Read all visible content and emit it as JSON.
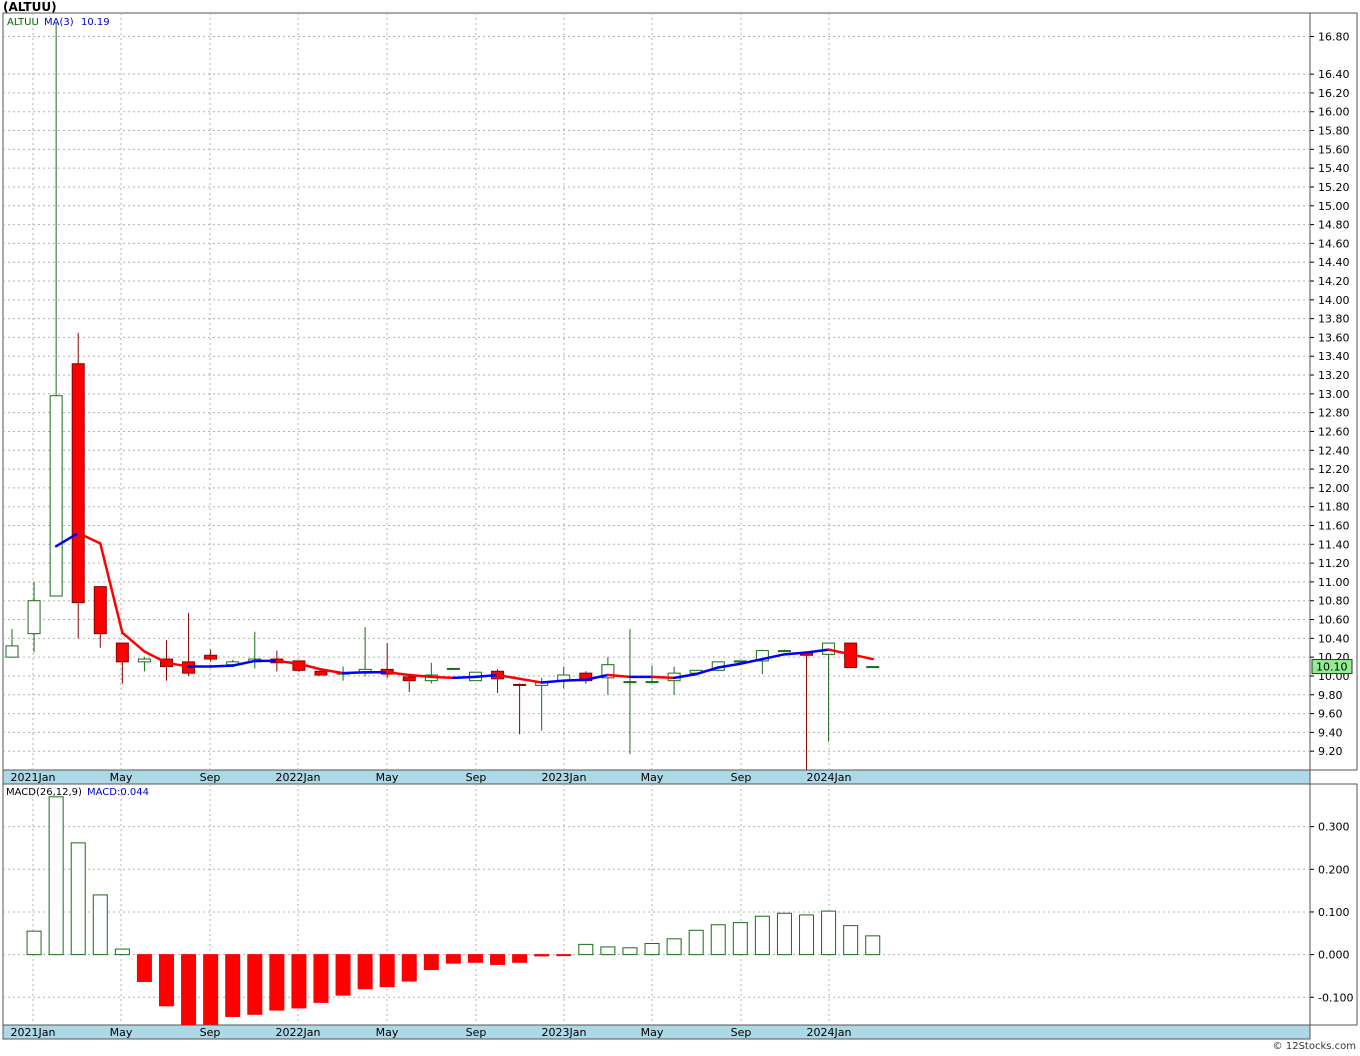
{
  "title": "(ALTUU)",
  "footer": "© 12Stocks.com",
  "colors": {
    "up": "#1a6b1a",
    "down": "#ff0000",
    "ma_up": "#0000ff",
    "ma_down": "#ff0000",
    "axis_band": "#add8e6",
    "last_box": "#90ee90"
  },
  "chart_data": [
    {
      "type": "candlestick",
      "legend": {
        "symbol": "ALTUU",
        "ma_label": "MA(3)",
        "ma_value": "10.19"
      },
      "last_price_label": "10.10",
      "ylim": [
        9.0,
        17.05
      ],
      "y_ticks": [
        "16.80",
        "16.40",
        "16.20",
        "16.00",
        "15.80",
        "15.60",
        "15.40",
        "15.20",
        "15.00",
        "14.80",
        "14.60",
        "14.40",
        "14.20",
        "14.00",
        "13.80",
        "13.60",
        "13.40",
        "13.20",
        "13.00",
        "12.80",
        "12.60",
        "12.40",
        "12.20",
        "12.00",
        "11.80",
        "11.60",
        "11.40",
        "11.20",
        "11.00",
        "10.80",
        "10.60",
        "10.40",
        "10.20",
        "10.00",
        "9.80",
        "9.60",
        "9.40",
        "9.20"
      ],
      "x_labels": [
        "2021Jan",
        "May",
        "Sep",
        "2022Jan",
        "May",
        "Sep",
        "2023Jan",
        "May",
        "Sep",
        "2024Jan"
      ],
      "candles": [
        {
          "o": 10.2,
          "h": 10.5,
          "l": 10.2,
          "c": 10.32
        },
        {
          "o": 10.45,
          "h": 11.0,
          "l": 10.25,
          "c": 10.8
        },
        {
          "o": 10.85,
          "h": 16.95,
          "l": 10.85,
          "c": 12.98
        },
        {
          "o": 13.32,
          "h": 13.65,
          "l": 10.4,
          "c": 10.78
        },
        {
          "o": 10.95,
          "h": 10.95,
          "l": 10.3,
          "c": 10.45
        },
        {
          "o": 10.35,
          "h": 10.35,
          "l": 9.92,
          "c": 10.15
        },
        {
          "o": 10.15,
          "h": 10.2,
          "l": 10.05,
          "c": 10.18
        },
        {
          "o": 10.18,
          "h": 10.38,
          "l": 9.95,
          "c": 10.1
        },
        {
          "o": 10.15,
          "h": 10.67,
          "l": 10.0,
          "c": 10.03
        },
        {
          "o": 10.22,
          "h": 10.28,
          "l": 10.15,
          "c": 10.18
        },
        {
          "o": 10.12,
          "h": 10.17,
          "l": 10.1,
          "c": 10.15
        },
        {
          "o": 10.15,
          "h": 10.47,
          "l": 10.08,
          "c": 10.18
        },
        {
          "o": 10.18,
          "h": 10.27,
          "l": 10.05,
          "c": 10.14
        },
        {
          "o": 10.16,
          "h": 10.16,
          "l": 10.04,
          "c": 10.06
        },
        {
          "o": 10.05,
          "h": 10.05,
          "l": 10.01,
          "c": 10.01
        },
        {
          "o": 10.02,
          "h": 10.1,
          "l": 9.95,
          "c": 10.03
        },
        {
          "o": 10.03,
          "h": 10.52,
          "l": 10.0,
          "c": 10.07
        },
        {
          "o": 10.07,
          "h": 10.35,
          "l": 9.98,
          "c": 10.02
        },
        {
          "o": 9.99,
          "h": 10.0,
          "l": 9.83,
          "c": 9.95
        },
        {
          "o": 9.95,
          "h": 10.14,
          "l": 9.92,
          "c": 10.01
        },
        {
          "o": 10.08,
          "h": 10.08,
          "l": 10.08,
          "c": 10.08
        },
        {
          "o": 9.95,
          "h": 10.04,
          "l": 9.95,
          "c": 10.04
        },
        {
          "o": 10.05,
          "h": 10.07,
          "l": 9.82,
          "c": 9.97
        },
        {
          "o": 9.91,
          "h": 9.92,
          "l": 9.38,
          "c": 9.9
        },
        {
          "o": 9.9,
          "h": 9.98,
          "l": 9.42,
          "c": 9.93
        },
        {
          "o": 9.95,
          "h": 10.1,
          "l": 9.87,
          "c": 10.01
        },
        {
          "o": 10.03,
          "h": 10.05,
          "l": 9.92,
          "c": 9.95
        },
        {
          "o": 9.98,
          "h": 10.2,
          "l": 9.8,
          "c": 10.12
        },
        {
          "o": 9.94,
          "h": 10.5,
          "l": 9.17,
          "c": 9.94
        },
        {
          "o": 9.94,
          "h": 10.11,
          "l": 9.93,
          "c": 9.94
        },
        {
          "o": 9.95,
          "h": 10.1,
          "l": 9.8,
          "c": 10.03
        },
        {
          "o": 10.03,
          "h": 10.05,
          "l": 10.02,
          "c": 10.06
        },
        {
          "o": 10.06,
          "h": 10.15,
          "l": 10.05,
          "c": 10.15
        },
        {
          "o": 10.16,
          "h": 10.16,
          "l": 10.15,
          "c": 10.16
        },
        {
          "o": 10.16,
          "h": 10.28,
          "l": 10.02,
          "c": 10.27
        },
        {
          "o": 10.27,
          "h": 10.28,
          "l": 10.27,
          "c": 10.27
        },
        {
          "o": 10.25,
          "h": 10.25,
          "l": 9.0,
          "c": 10.22
        },
        {
          "o": 10.23,
          "h": 10.35,
          "l": 9.3,
          "c": 10.35
        },
        {
          "o": 10.35,
          "h": 10.35,
          "l": 10.08,
          "c": 10.09
        },
        {
          "o": 10.1,
          "h": 10.1,
          "l": 10.1,
          "c": 10.1
        }
      ],
      "ma3": [
        null,
        null,
        11.38,
        11.52,
        11.41,
        10.46,
        10.26,
        10.14,
        10.1,
        10.1,
        10.11,
        10.16,
        10.16,
        10.13,
        10.07,
        10.03,
        10.04,
        10.04,
        10.01,
        9.99,
        9.98,
        9.99,
        10.01,
        9.97,
        9.93,
        9.95,
        9.96,
        10.01,
        9.99,
        9.99,
        9.98,
        10.02,
        10.09,
        10.13,
        10.18,
        10.23,
        10.25,
        10.28,
        10.23,
        10.18
      ]
    },
    {
      "type": "bar",
      "legend": {
        "label": "MACD(26,12,9)",
        "value_label": "MACD:0.044"
      },
      "ylim": [
        -0.165,
        0.4
      ],
      "y_ticks": [
        "0.300",
        "0.200",
        "0.100",
        "0.000",
        "-0.100"
      ],
      "x_labels": [
        "2021Jan",
        "May",
        "Sep",
        "2022Jan",
        "May",
        "Sep",
        "2023Jan",
        "May",
        "Sep",
        "2024Jan"
      ],
      "values": [
        0.055,
        0.37,
        0.262,
        0.14,
        0.013,
        -0.063,
        -0.12,
        -0.165,
        -0.163,
        -0.145,
        -0.14,
        -0.13,
        -0.125,
        -0.112,
        -0.095,
        -0.08,
        -0.075,
        -0.062,
        -0.035,
        -0.02,
        -0.018,
        -0.023,
        -0.018,
        -0.003,
        -0.001,
        0.024,
        0.018,
        0.016,
        0.026,
        0.037,
        0.057,
        0.07,
        0.075,
        0.09,
        0.097,
        0.093,
        0.102,
        0.068,
        0.044
      ]
    }
  ]
}
